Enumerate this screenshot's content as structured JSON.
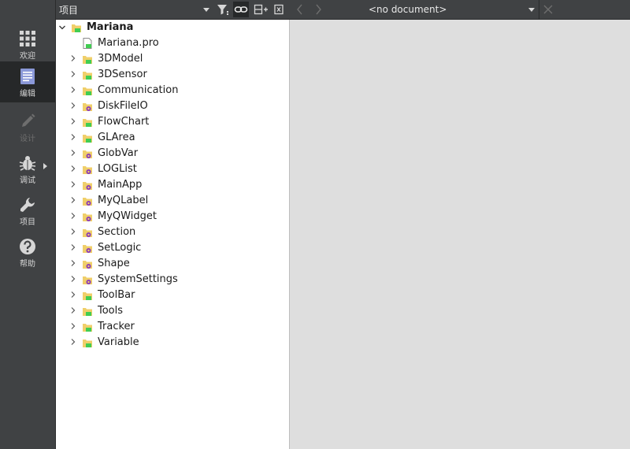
{
  "modes": [
    {
      "label": "欢迎",
      "icon": "welcome-grid-icon"
    },
    {
      "label": "编辑",
      "icon": "edit-document-icon"
    },
    {
      "label": "设计",
      "icon": "design-pencil-icon"
    },
    {
      "label": "调试",
      "icon": "debug-bug-icon"
    },
    {
      "label": "项目",
      "icon": "projects-wrench-icon"
    },
    {
      "label": "帮助",
      "icon": "help-question-icon"
    }
  ],
  "tree_header": {
    "title": "项目",
    "buttons": [
      "filter-icon",
      "link-with-editor-icon",
      "split-icon",
      "close-pane-icon"
    ]
  },
  "project": {
    "name": "Mariana",
    "pro_file": "Mariana.pro",
    "folders": [
      "3DModel",
      "3DSensor",
      "Communication",
      "DiskFileIO",
      "FlowChart",
      "GLArea",
      "GlobVar",
      "LOGList",
      "MainApp",
      "MyQLabel",
      "MyQWidget",
      "Section",
      "SetLogic",
      "Shape",
      "SystemSettings",
      "ToolBar",
      "Tools",
      "Tracker",
      "Variable"
    ],
    "folder_types": [
      "qt",
      "qt",
      "qt",
      "gear",
      "qt",
      "qt",
      "gear",
      "gear",
      "gear",
      "gear",
      "gear",
      "gear",
      "gear",
      "gear",
      "gear",
      "qt",
      "qt",
      "qt",
      "qt"
    ]
  },
  "editor": {
    "document": "<no document>"
  },
  "colors": {
    "sidebar_bg": "#404244",
    "active_mode_bg": "#262829",
    "tree_bg": "#ffffff",
    "editor_bg": "#dedede",
    "folder_yellow": "#f0cf6a",
    "qt_green": "#41cd52",
    "gear_purple": "#8a3ab9"
  }
}
